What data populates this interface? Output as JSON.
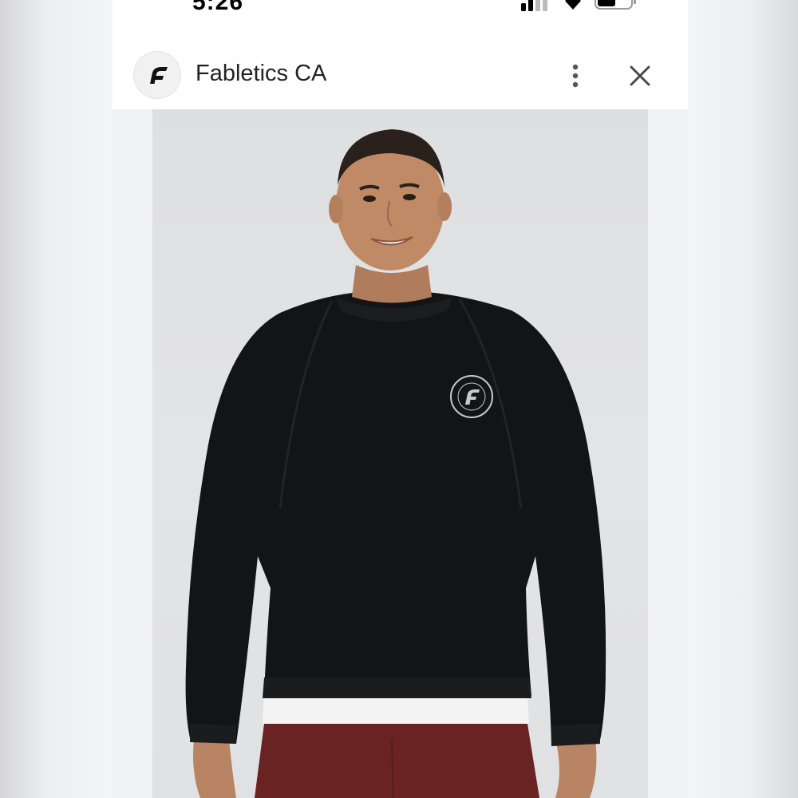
{
  "status_bar": {
    "time": "5:26",
    "icons": [
      "signal-icon",
      "wifi-icon",
      "battery-icon"
    ]
  },
  "header": {
    "logo_icon": "fabletics-logo-icon",
    "title": "Fabletics CA",
    "more_icon": "more-vertical-icon",
    "close_icon": "close-icon"
  },
  "product_image": {
    "description_icon": "product-photo"
  },
  "colors": {
    "header_bg": "#ffffff",
    "image_bg": "#e0e1e3",
    "sweater": "#111214",
    "pants": "#6b2424"
  }
}
